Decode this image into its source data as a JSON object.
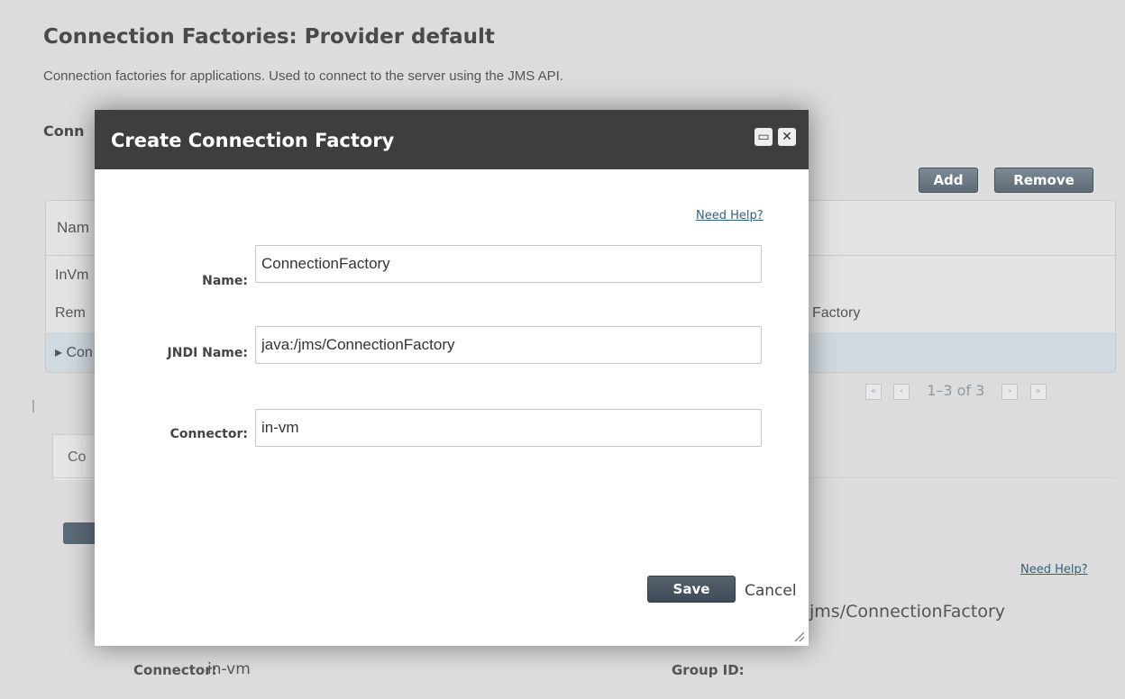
{
  "background": {
    "title": "Connection Factories: Provider default",
    "description": "Connection factories for applications. Used to connect to the server using the JMS API.",
    "section_title": "Conn",
    "add_label": "Add",
    "remove_label": "Remove",
    "table": {
      "header": "Nam",
      "rows": [
        {
          "name": "InVm",
          "extra": ""
        },
        {
          "name": "Rem",
          "extra": "Factory"
        },
        {
          "name": "▸ Con",
          "extra": ""
        }
      ]
    },
    "pager_text": "1–3 of 3",
    "tab_label": "Co",
    "help_link": "Need Help?",
    "jndi_value": "jms/ConnectionFactory",
    "connector_label": "Connector:",
    "connector_value": "in-vm",
    "group_id_label": "Group ID:"
  },
  "dialog": {
    "title": "Create Connection Factory",
    "help_link": "Need Help?",
    "fields": {
      "name": {
        "label": "Name:",
        "value": "ConnectionFactory"
      },
      "jndi": {
        "label": "JNDI Name:",
        "value": "java:/jms/ConnectionFactory"
      },
      "connector": {
        "label": "Connector:",
        "value": "in-vm"
      }
    },
    "save_label": "Save",
    "cancel_label": "Cancel"
  },
  "colors": {
    "dialog_header": "#3d3e40",
    "button": "#5d6b77",
    "link": "#30617e",
    "selected_row": "#cfd9df"
  }
}
